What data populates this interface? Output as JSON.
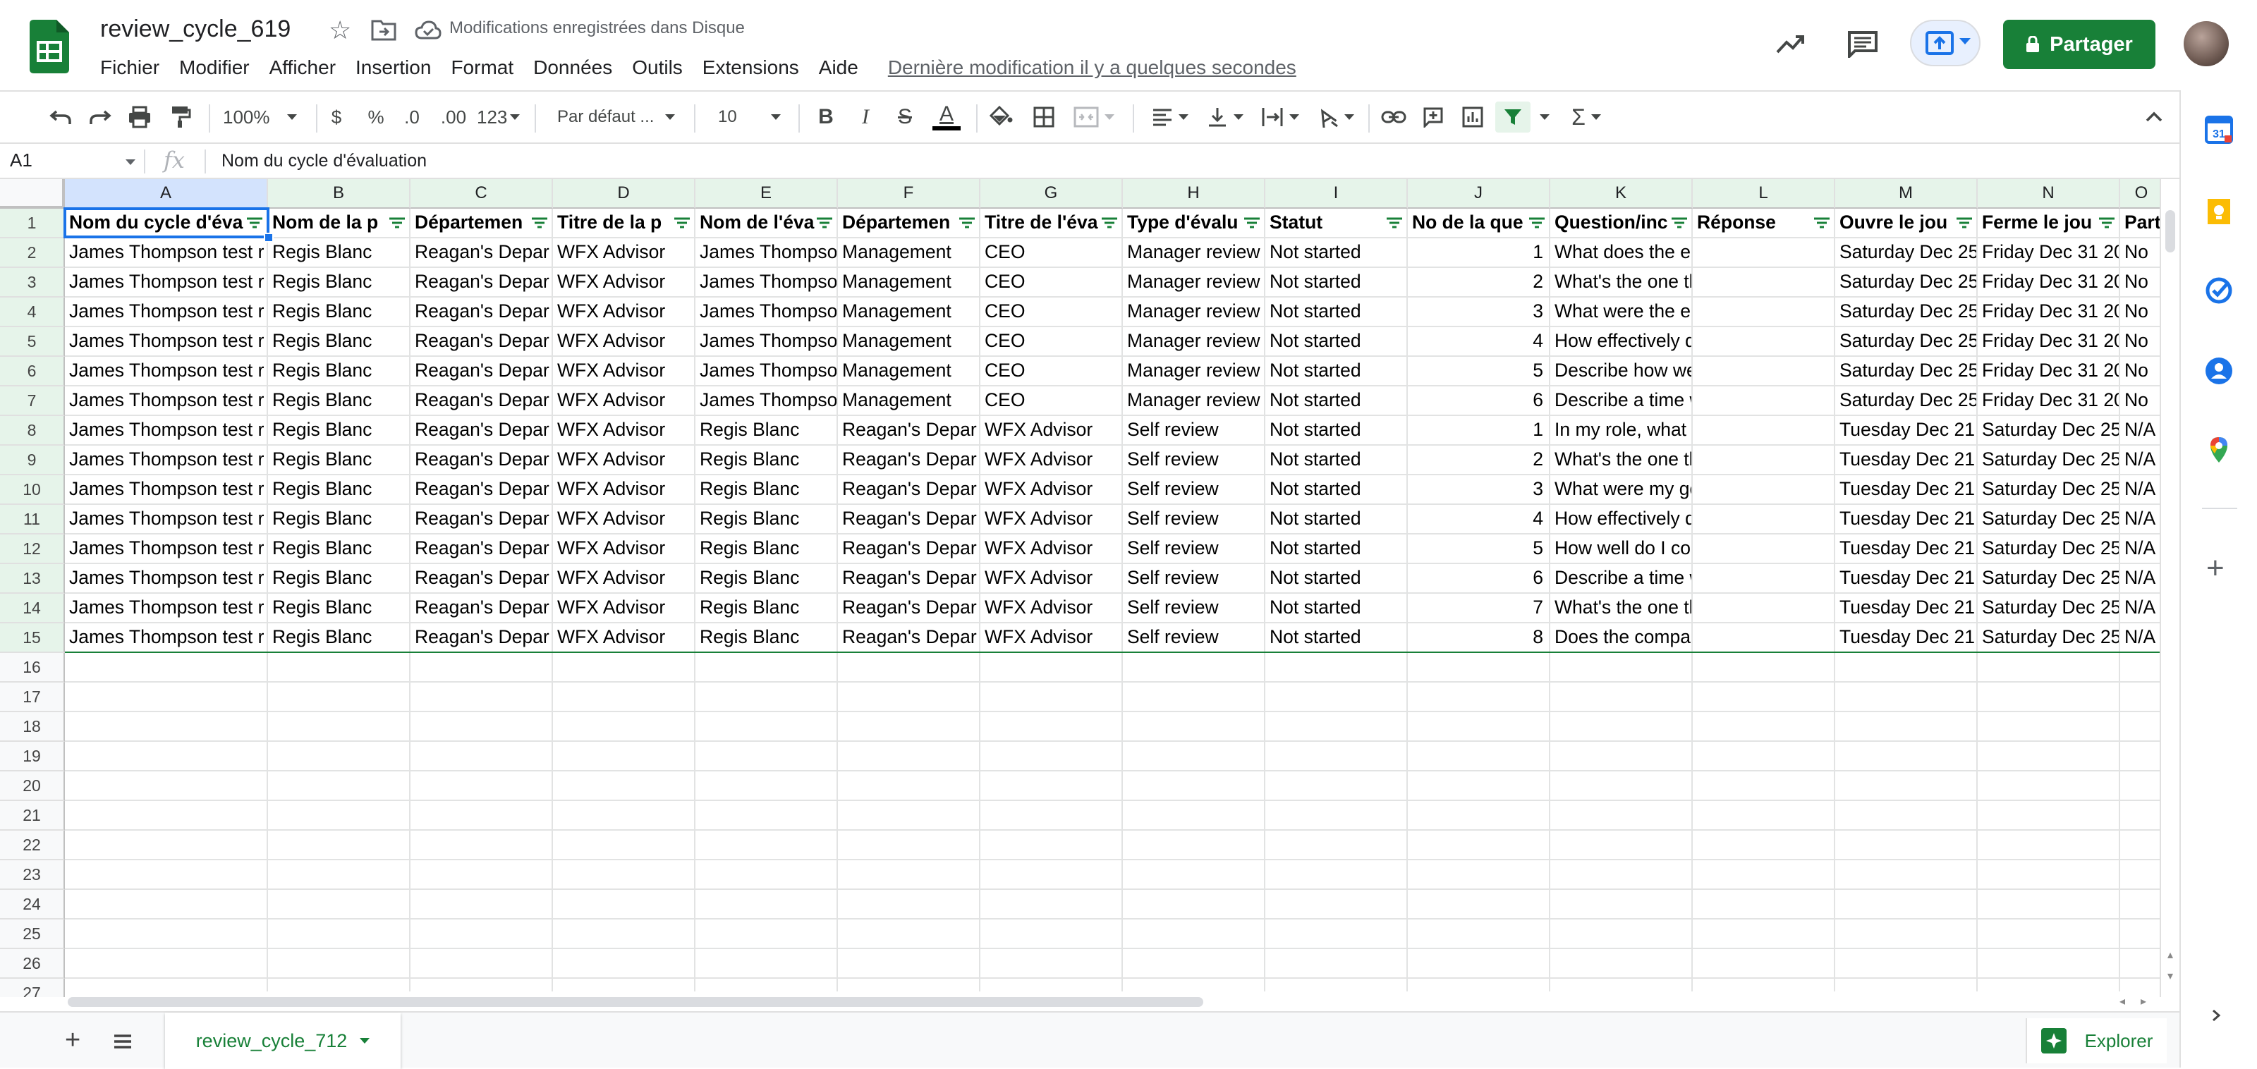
{
  "doc": {
    "title": "review_cycle_619",
    "save_status": "Modifications enregistrées dans Disque",
    "last_edit": "Dernière modification il y a quelques secondes",
    "share_label": "Partager",
    "brand_color": "#188038"
  },
  "menu": [
    "Fichier",
    "Modifier",
    "Afficher",
    "Insertion",
    "Format",
    "Données",
    "Outils",
    "Extensions",
    "Aide"
  ],
  "toolbar": {
    "zoom": "100%",
    "currency": "$",
    "percent": "%",
    "dec_decrease": ".0",
    "dec_increase": ".00",
    "more_formats": "123",
    "font": "Par défaut ...",
    "font_size": "10",
    "bold": "B",
    "italic": "I",
    "strike": "S",
    "text_color": "A",
    "sum": "Σ"
  },
  "formula_bar": {
    "cell_ref": "A1",
    "fx": "fx",
    "value": "Nom du cycle d'évaluation"
  },
  "grid": {
    "columns": [
      "A",
      "B",
      "C",
      "D",
      "E",
      "F",
      "G",
      "H",
      "I",
      "J",
      "K",
      "L",
      "M",
      "N",
      "O"
    ],
    "row_numbers": [
      "1",
      "2",
      "3",
      "4",
      "5",
      "6",
      "7",
      "8",
      "9",
      "10",
      "11",
      "12",
      "13",
      "14",
      "15",
      "16",
      "17",
      "18",
      "19",
      "20",
      "21",
      "22",
      "23",
      "24",
      "25",
      "26",
      "27"
    ],
    "header_row": [
      "Nom du cycle d'éva",
      "Nom de la p",
      "Départemen",
      "Titre de la p",
      "Nom de l'éva",
      "Départemen",
      "Titre de l'éva",
      "Type d'évalu",
      "Statut",
      "No de la que",
      "Question/inc",
      "Réponse",
      "Ouvre le jou",
      "Ferme le jou",
      "Part"
    ],
    "rows": [
      [
        "James Thompson test r",
        "Regis Blanc",
        "Reagan's Depar",
        "WFX Advisor",
        "James Thompso",
        "Management",
        "CEO",
        "Manager review",
        "Not started",
        "1",
        "What does the employee do well?",
        "",
        "Saturday Dec 25",
        "Friday Dec 31 20",
        "No"
      ],
      [
        "James Thompson test r",
        "Regis Blanc",
        "Reagan's Depar",
        "WFX Advisor",
        "James Thompso",
        "Management",
        "CEO",
        "Manager review",
        "Not started",
        "2",
        "What's the one thing the employe",
        "",
        "Saturday Dec 25",
        "Friday Dec 31 20",
        "No"
      ],
      [
        "James Thompson test r",
        "Regis Blanc",
        "Reagan's Depar",
        "WFX Advisor",
        "James Thompso",
        "Management",
        "CEO",
        "Manager review",
        "Not started",
        "3",
        "What were the employee's goals a",
        "",
        "Saturday Dec 25",
        "Friday Dec 31 20",
        "No"
      ],
      [
        "James Thompson test r",
        "Regis Blanc",
        "Reagan's Depar",
        "WFX Advisor",
        "James Thompso",
        "Management",
        "CEO",
        "Manager review",
        "Not started",
        "4",
        "How effectively does the employe",
        "",
        "Saturday Dec 25",
        "Friday Dec 31 20",
        "No"
      ],
      [
        "James Thompson test r",
        "Regis Blanc",
        "Reagan's Depar",
        "WFX Advisor",
        "James Thompso",
        "Management",
        "CEO",
        "Manager review",
        "Not started",
        "5",
        "Describe how well the employee c",
        "",
        "Saturday Dec 25",
        "Friday Dec 31 20",
        "No"
      ],
      [
        "James Thompson test r",
        "Regis Blanc",
        "Reagan's Depar",
        "WFX Advisor",
        "James Thompso",
        "Management",
        "CEO",
        "Manager review",
        "Not started",
        "6",
        "Describe a time when the employ",
        "",
        "Saturday Dec 25",
        "Friday Dec 31 20",
        "No"
      ],
      [
        "James Thompson test r",
        "Regis Blanc",
        "Reagan's Depar",
        "WFX Advisor",
        "Regis Blanc",
        "Reagan's Depar",
        "WFX Advisor",
        "Self review",
        "Not started",
        "1",
        "In my role, what do I do well?",
        "",
        "Tuesday Dec 21",
        "Saturday Dec 25",
        "N/A"
      ],
      [
        "James Thompson test r",
        "Regis Blanc",
        "Reagan's Depar",
        "WFX Advisor",
        "Regis Blanc",
        "Reagan's Depar",
        "WFX Advisor",
        "Self review",
        "Not started",
        "2",
        "What's the one thing I could do to",
        "",
        "Tuesday Dec 21",
        "Saturday Dec 25",
        "N/A"
      ],
      [
        "James Thompson test r",
        "Regis Blanc",
        "Reagan's Depar",
        "WFX Advisor",
        "Regis Blanc",
        "Reagan's Depar",
        "WFX Advisor",
        "Self review",
        "Not started",
        "3",
        "What were my goals and to what",
        "",
        "Tuesday Dec 21",
        "Saturday Dec 25",
        "N/A"
      ],
      [
        "James Thompson test r",
        "Regis Blanc",
        "Reagan's Depar",
        "WFX Advisor",
        "Regis Blanc",
        "Reagan's Depar",
        "WFX Advisor",
        "Self review",
        "Not started",
        "4",
        "How effectively do I prioritize and",
        "",
        "Tuesday Dec 21",
        "Saturday Dec 25",
        "N/A"
      ],
      [
        "James Thompson test r",
        "Regis Blanc",
        "Reagan's Depar",
        "WFX Advisor",
        "Regis Blanc",
        "Reagan's Depar",
        "WFX Advisor",
        "Self review",
        "Not started",
        "5",
        "How well do I communicate with c",
        "",
        "Tuesday Dec 21",
        "Saturday Dec 25",
        "N/A"
      ],
      [
        "James Thompson test r",
        "Regis Blanc",
        "Reagan's Depar",
        "WFX Advisor",
        "Regis Blanc",
        "Reagan's Depar",
        "WFX Advisor",
        "Self review",
        "Not started",
        "6",
        "Describe a time when my work re",
        "",
        "Tuesday Dec 21",
        "Saturday Dec 25",
        "N/A"
      ],
      [
        "James Thompson test r",
        "Regis Blanc",
        "Reagan's Depar",
        "WFX Advisor",
        "Regis Blanc",
        "Reagan's Depar",
        "WFX Advisor",
        "Self review",
        "Not started",
        "7",
        "What's the one thing the company",
        "",
        "Tuesday Dec 21",
        "Saturday Dec 25",
        "N/A"
      ],
      [
        "James Thompson test r",
        "Regis Blanc",
        "Reagan's Depar",
        "WFX Advisor",
        "Regis Blanc",
        "Reagan's Depar",
        "WFX Advisor",
        "Self review",
        "Not started",
        "8",
        "Does the company recognize my",
        "",
        "Tuesday Dec 21",
        "Saturday Dec 25",
        "N/A"
      ]
    ]
  },
  "sheets": {
    "active_tab": "review_cycle_712",
    "explore_label": "Explorer"
  },
  "side_panel": {
    "icons": [
      "calendar-icon",
      "keep-icon",
      "tasks-icon",
      "contacts-icon",
      "maps-icon"
    ]
  }
}
